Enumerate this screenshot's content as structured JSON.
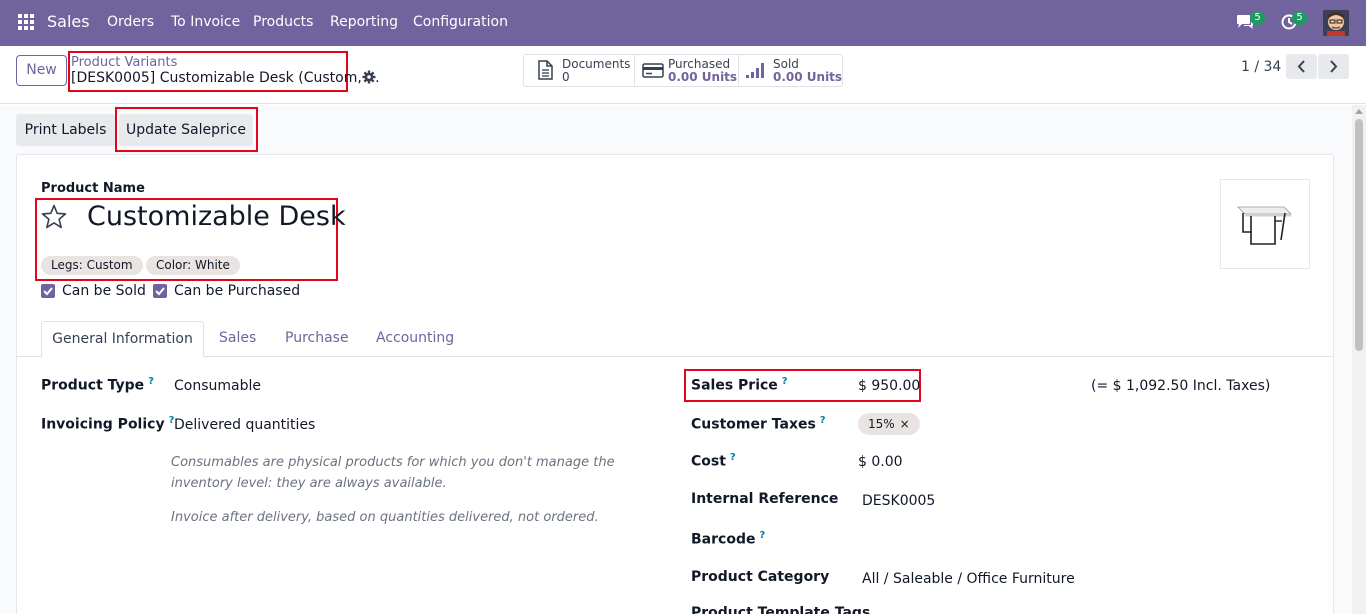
{
  "navbar": {
    "app_name": "Sales",
    "menu": [
      "Orders",
      "To Invoice",
      "Products",
      "Reporting",
      "Configuration"
    ],
    "messages_count": "5",
    "activities_count": "5",
    "apps_icon": "grid-icon",
    "chat_icon": "chat-icon",
    "activity_icon": "clock-icon",
    "color": "#71639e"
  },
  "control_panel": {
    "new_button": "New",
    "breadcrumb_parent": "Product Variants",
    "breadcrumb_current": "[DESK0005] Customizable Desk (Custom, ...",
    "smart_buttons": [
      {
        "label": "Documents",
        "value": "0",
        "icon": "document-icon"
      },
      {
        "label": "Purchased",
        "value": "0.00 Units",
        "icon": "credit-card-icon"
      },
      {
        "label": "Sold",
        "value": "0.00 Units",
        "icon": "bar-chart-icon"
      }
    ],
    "pager": "1 / 34"
  },
  "actions": {
    "print_labels": "Print Labels",
    "update_saleprice": "Update Saleprice"
  },
  "product": {
    "name_label": "Product Name",
    "name": "Customizable Desk",
    "attributes": [
      "Legs: Custom",
      "Color: White"
    ],
    "can_be_sold_label": "Can be Sold",
    "can_be_purchased_label": "Can be Purchased",
    "can_be_sold": true,
    "can_be_purchased": true
  },
  "tabs": [
    "General Information",
    "Sales",
    "Purchase",
    "Accounting"
  ],
  "general": {
    "product_type_label": "Product Type",
    "product_type": "Consumable",
    "invoicing_policy_label": "Invoicing Policy",
    "invoicing_policy": "Delivered quantities",
    "help_consumable": "Consumables are physical products for which you don't manage the inventory level: they are always available.",
    "help_invoice": "Invoice after delivery, based on quantities delivered, not ordered.",
    "sales_price_label": "Sales Price",
    "sales_price": "$ 950.00",
    "incl_taxes": "(= $ 1,092.50 Incl. Taxes)",
    "customer_taxes_label": "Customer Taxes",
    "customer_tax": "15%",
    "cost_label": "Cost",
    "cost": "$ 0.00",
    "internal_reference_label": "Internal Reference",
    "internal_reference": "DESK0005",
    "barcode_label": "Barcode",
    "product_category_label": "Product Category",
    "product_category": "All / Saleable / Office Furniture",
    "product_template_tags_label": "Product Template Tags",
    "help_marker": "?"
  }
}
